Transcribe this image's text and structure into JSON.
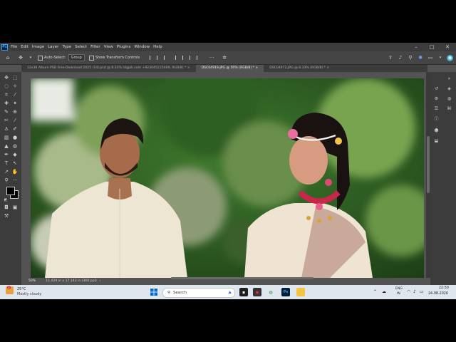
{
  "menu": {
    "logo": "Ps",
    "items": [
      "File",
      "Edit",
      "Image",
      "Layer",
      "Type",
      "Select",
      "Filter",
      "View",
      "Plugins",
      "Window",
      "Help"
    ]
  },
  "options": {
    "auto_select_label": "Auto-Select:",
    "auto_select_value": "Group",
    "show_transform_label": "Show Transform Controls"
  },
  "tabs": [
    {
      "label": "12x36 Album PSD Free-Download 2025 (14).psd @ 8.33% (dgpik.com +923045215409, RGB/8) *",
      "close": "×"
    },
    {
      "label": "DSC04919.JPG @ 50% (RGB/8) *",
      "close": "×"
    },
    {
      "label": "DSC04972.JPG @ 8.33% (RGB/8) *",
      "close": "×"
    }
  ],
  "status": {
    "zoom": "50%",
    "doc_info": "11.429 in x 17.143 in (360 ppi)",
    "arrow": "›"
  },
  "taskbar": {
    "weather_temp": "25°C",
    "weather_desc": "Mostly cloudy",
    "weather_badge": "3",
    "search_placeholder": "Search",
    "lang": "ENG",
    "region": "IN",
    "time": "22:50",
    "date": "24-08-2026"
  },
  "colors": {
    "foreground": "#000000",
    "background": "#000000"
  }
}
